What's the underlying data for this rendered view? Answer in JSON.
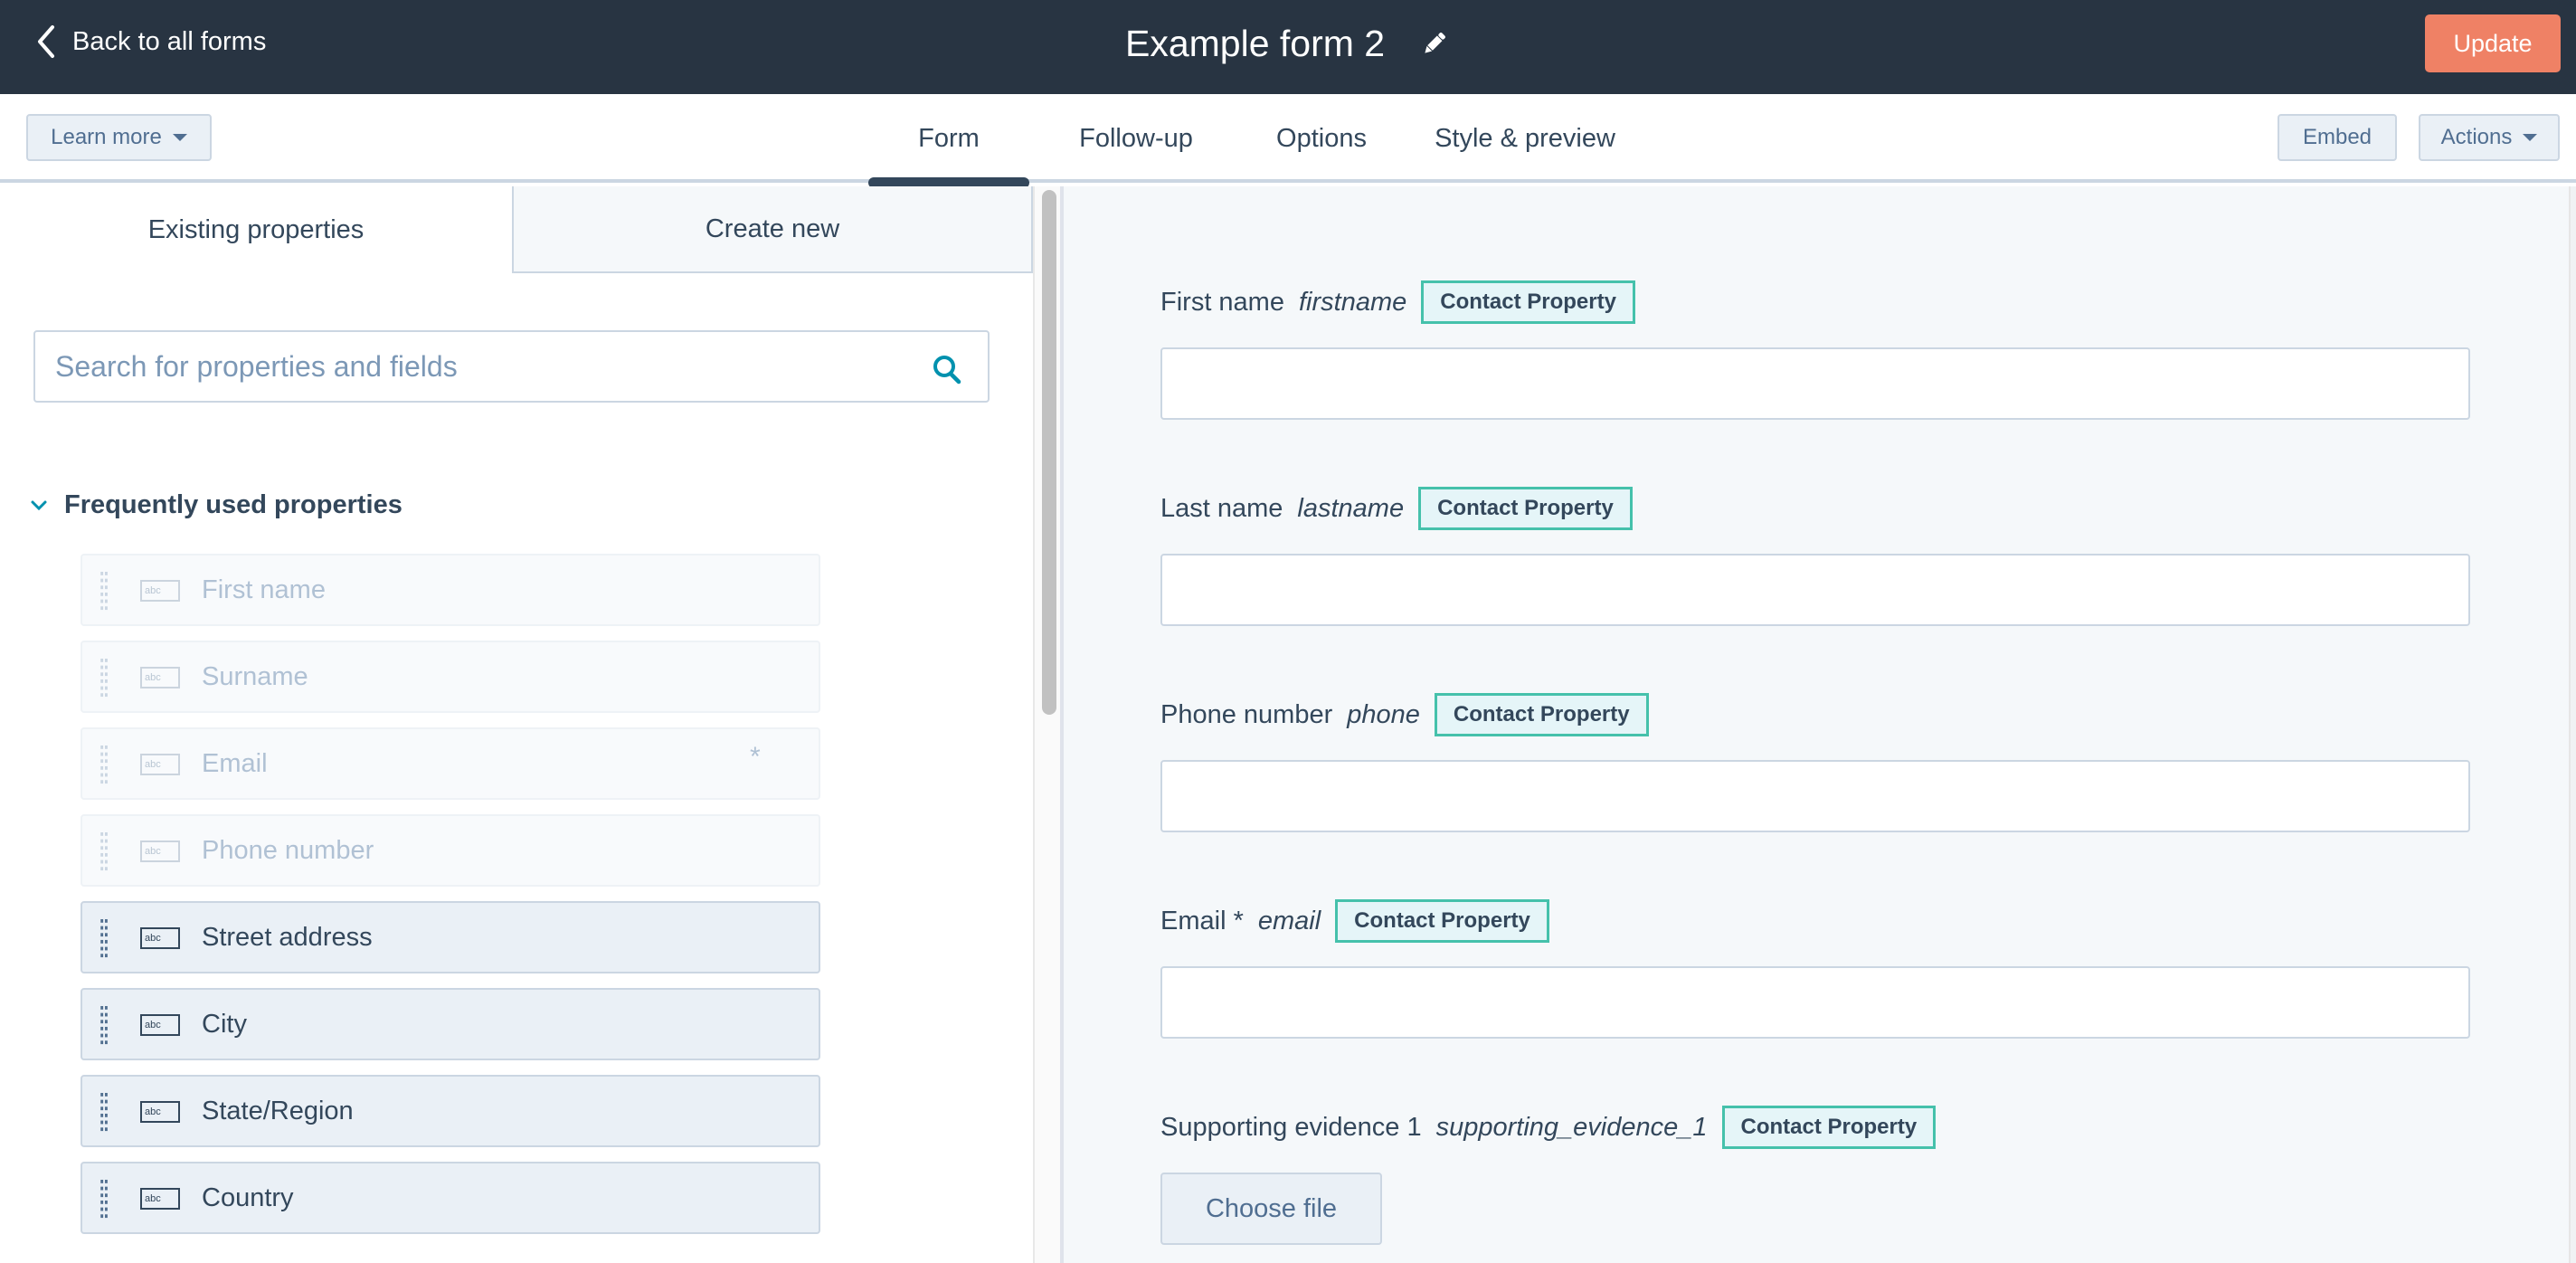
{
  "header": {
    "back_label": "Back to all forms",
    "form_title": "Example form 2",
    "update_label": "Update",
    "colors": {
      "header_bg": "#283442",
      "update_bg": "#ef8165"
    }
  },
  "subnav": {
    "learn_more_label": "Learn more",
    "tabs": [
      {
        "label": "Form",
        "active": true
      },
      {
        "label": "Follow-up",
        "active": false
      },
      {
        "label": "Options",
        "active": false
      },
      {
        "label": "Style & preview",
        "active": false
      }
    ],
    "embed_label": "Embed",
    "actions_label": "Actions"
  },
  "left_panel": {
    "tabs": [
      {
        "label": "Existing properties",
        "active": true
      },
      {
        "label": "Create new",
        "active": false
      }
    ],
    "search": {
      "placeholder": "Search for properties and fields",
      "value": ""
    },
    "section_title": "Frequently used properties",
    "properties": [
      {
        "label": "First name",
        "state": "disabled",
        "required": false
      },
      {
        "label": "Surname",
        "state": "disabled",
        "required": false
      },
      {
        "label": "Email",
        "state": "disabled",
        "required": true,
        "required_mark": "*"
      },
      {
        "label": "Phone number",
        "state": "disabled",
        "required": false
      },
      {
        "label": "Street address",
        "state": "enabled",
        "required": false
      },
      {
        "label": "City",
        "state": "enabled",
        "required": false
      },
      {
        "label": "State/Region",
        "state": "enabled",
        "required": false
      },
      {
        "label": "Country",
        "state": "enabled",
        "required": false
      }
    ],
    "field_type_icon_text": "abc"
  },
  "form_preview": {
    "badge_color": "#45c1ab",
    "fields": [
      {
        "label": "First name",
        "internal_name": "firstname",
        "badge": "Contact Property",
        "type": "text",
        "value": ""
      },
      {
        "label": "Last name",
        "internal_name": "lastname",
        "badge": "Contact Property",
        "type": "text",
        "value": ""
      },
      {
        "label": "Phone number",
        "internal_name": "phone",
        "badge": "Contact Property",
        "type": "text",
        "value": ""
      },
      {
        "label": "Email *",
        "internal_name": "email",
        "badge": "Contact Property",
        "type": "text",
        "value": ""
      },
      {
        "label": "Supporting evidence 1",
        "internal_name": "supporting_evidence_1",
        "badge": "Contact Property",
        "type": "file",
        "button_label": "Choose file"
      }
    ]
  }
}
